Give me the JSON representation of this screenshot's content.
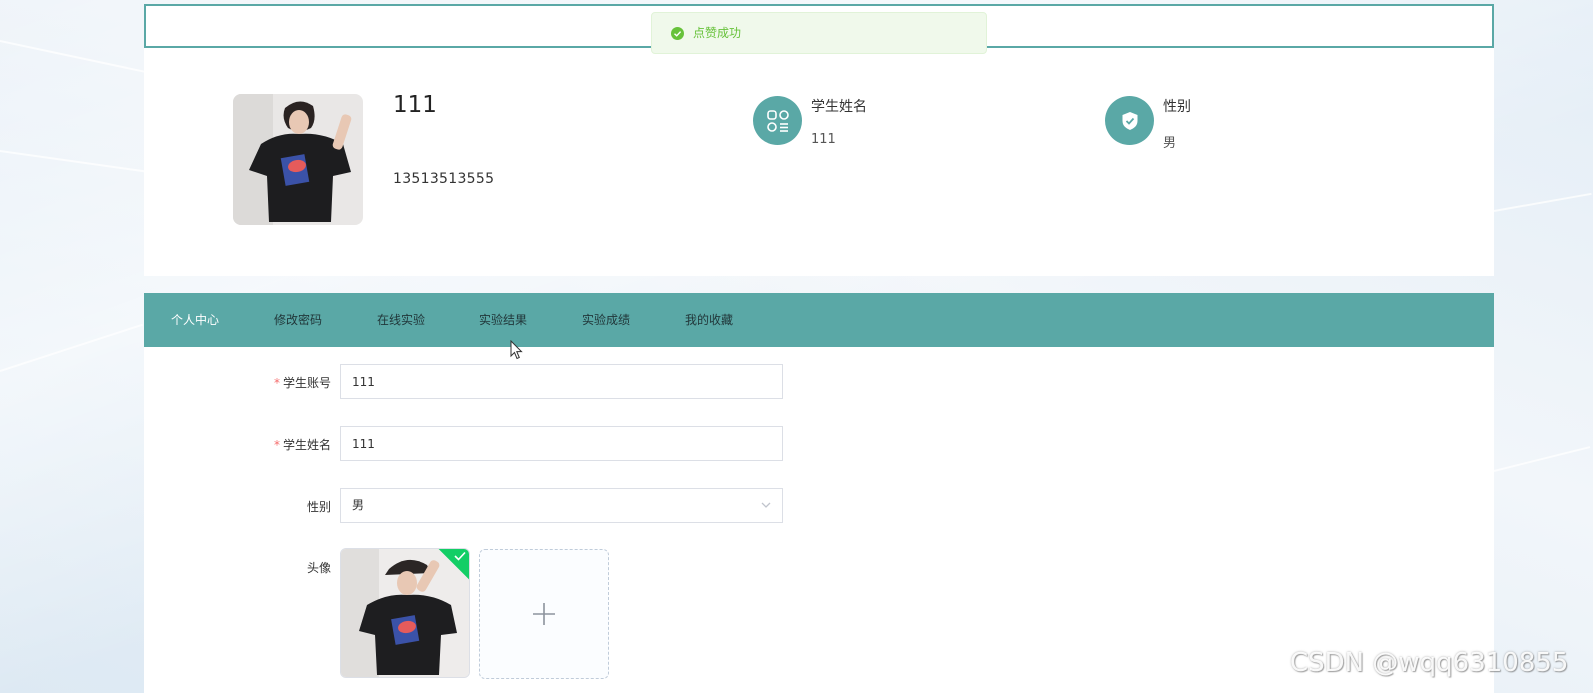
{
  "toast": {
    "message": "点赞成功",
    "icon": "check-circle-icon",
    "color": "#67c23a"
  },
  "profile": {
    "name": "111",
    "phone": "13513513555",
    "stats": [
      {
        "label": "学生姓名",
        "value": "111",
        "icon": "apps-list-icon"
      },
      {
        "label": "性别",
        "value": "男",
        "icon": "shield-check-icon"
      }
    ]
  },
  "tabs": [
    {
      "label": "个人中心",
      "active": true
    },
    {
      "label": "修改密码"
    },
    {
      "label": "在线实验"
    },
    {
      "label": "实验结果"
    },
    {
      "label": "实验成绩"
    },
    {
      "label": "我的收藏"
    }
  ],
  "form": {
    "account": {
      "required_mark": "*",
      "label": "学生账号",
      "value": "111"
    },
    "name": {
      "required_mark": "*",
      "label": "学生姓名",
      "value": "111"
    },
    "gender": {
      "label": "性别",
      "value": "男"
    },
    "avatar": {
      "label": "头像",
      "upload_icon": "plus-icon"
    }
  },
  "watermark": "CSDN @wqq6310855",
  "colors": {
    "accent": "#5aa8a6",
    "success": "#13ce66",
    "required": "#f56c6c"
  }
}
